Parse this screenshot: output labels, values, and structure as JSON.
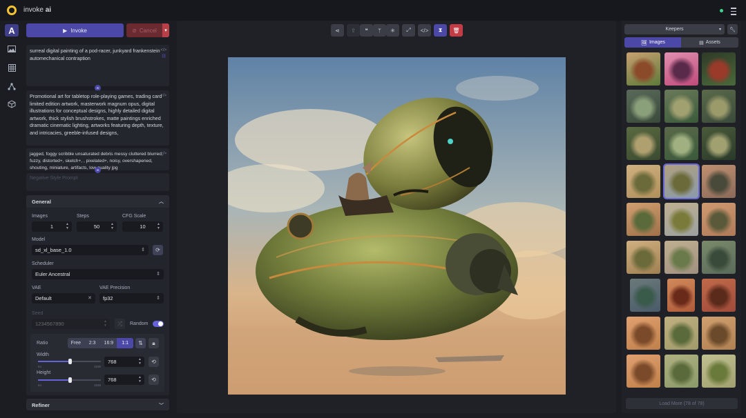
{
  "app": {
    "name_prefix": "invoke",
    "name_suffix": "ai"
  },
  "rail": [
    "text-to-image-icon",
    "image-icon",
    "grid-icon",
    "nodes-icon",
    "box-icon"
  ],
  "rail_active_label": "A",
  "actions": {
    "invoke": "Invoke",
    "cancel": "Cancel"
  },
  "prompts": {
    "positive": "surreal digital painting of a pod-racer, junkyard frankenstein automechanical contraption",
    "style": "Promotional art for tabletop role-playing games, trading card limited edition artwork, masterwork magnum opus, digital illustrations for conceptual designs, highly detailed digital artwork, thick stylish brushstrokes, matte paintings enriched dramatic cinematic lighting, artworks featuring depth, texture, and intricacies, greeble-infused designs,",
    "negative": "jagged, foggy scribble unsaturated debris messy cluttered blurred, fuzzy, distorted+, sketch+, , pixelated+, noisy, overshapened, shouting, miniature, artifacts, low quality jpg",
    "negative_style_placeholder": "Negative Style Prompt"
  },
  "general": {
    "title": "General",
    "images_label": "Images",
    "images": "1",
    "steps_label": "Steps",
    "steps": "50",
    "cfg_label": "CFG Scale",
    "cfg": "10",
    "model_label": "Model",
    "model": "sd_xl_base_1.0",
    "scheduler_label": "Scheduler",
    "scheduler": "Euler Ancestral",
    "vae_label": "VAE",
    "vae": "Default",
    "vae_precision_label": "VAE Precision",
    "vae_precision": "fp32",
    "seed_label": "Seed",
    "seed": "1234567890",
    "random_label": "Random",
    "random_on": true,
    "ratio_label": "Ratio",
    "ratios": [
      "Free",
      "2:3",
      "16:9",
      "1:1"
    ],
    "ratio_active": "1:1",
    "width_label": "Width",
    "width": "768",
    "width_fraction": 0.5,
    "height_label": "Height",
    "height": "768",
    "height_fraction": 0.5,
    "slider_min": "64",
    "slider_max": "1536"
  },
  "refiner": {
    "title": "Refiner"
  },
  "board": {
    "name": "Keepers"
  },
  "gallery_tabs": {
    "images": "Images",
    "assets": "Assets"
  },
  "load_more": "Load More (78 of 78)",
  "colors": {
    "accent": "#4b48a8",
    "danger": "#c23b45",
    "panel": "#23252c",
    "status_online": "#3dd68c"
  }
}
